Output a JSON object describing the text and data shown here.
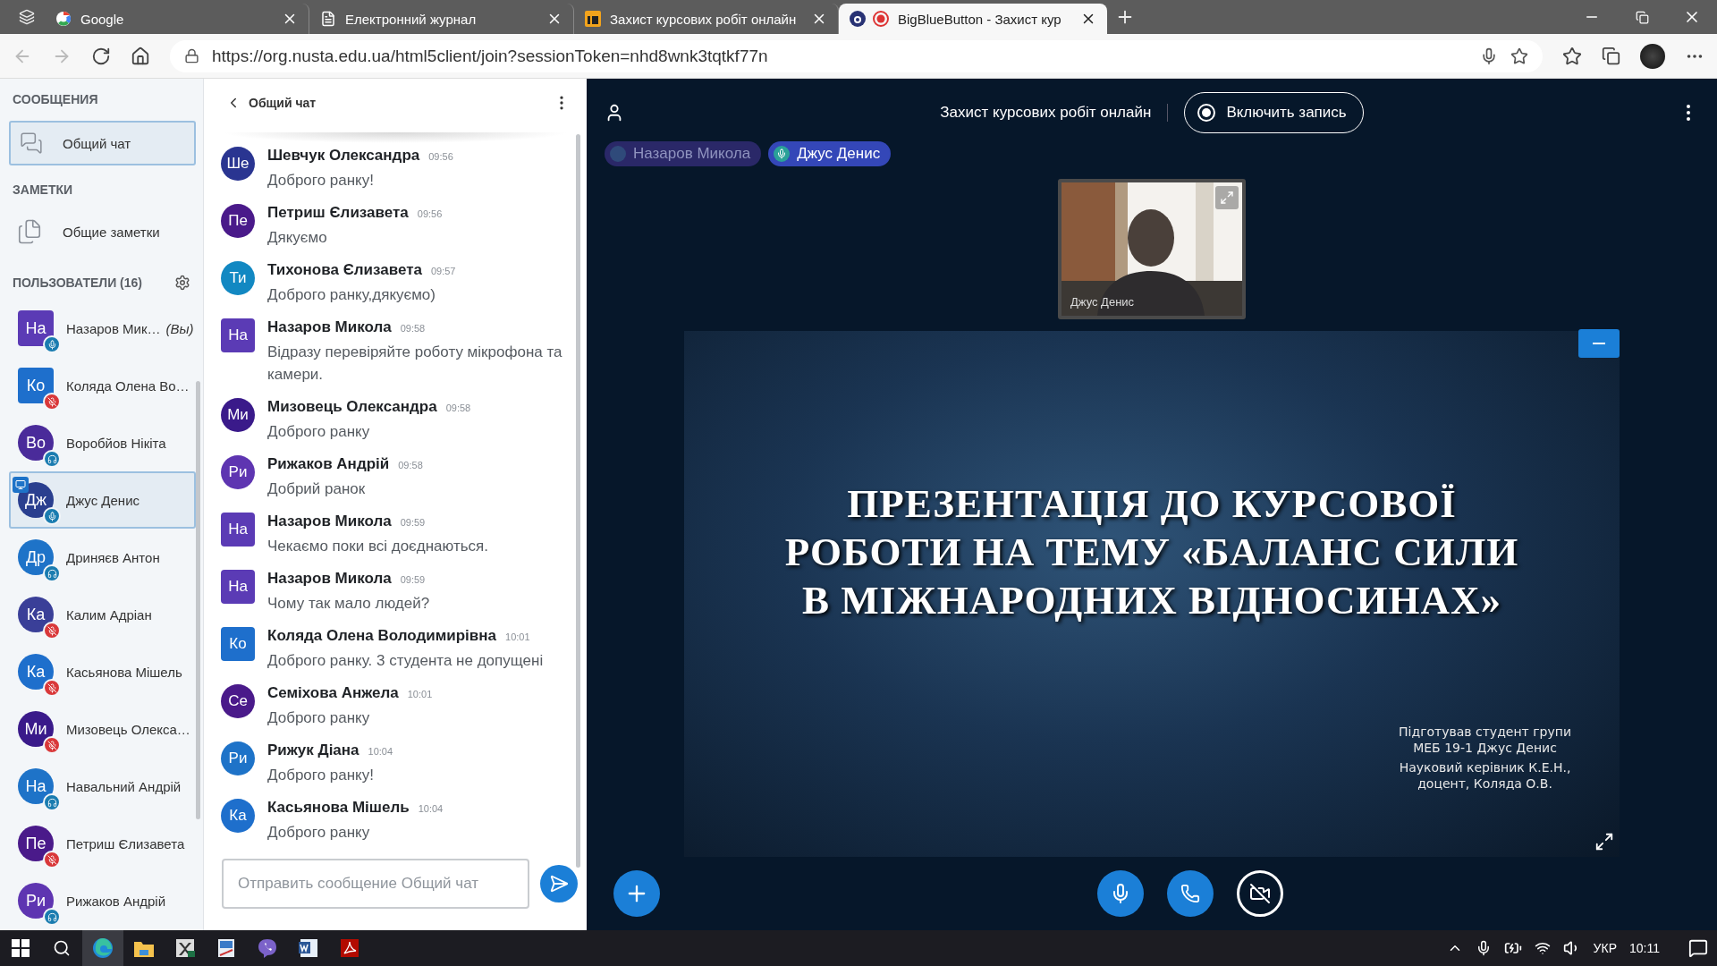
{
  "browser": {
    "tabs": [
      {
        "title": "Google",
        "kind": "google",
        "selected": false
      },
      {
        "title": "Електронний журнал",
        "kind": "page",
        "selected": false
      },
      {
        "title": "Захист курсових робіт онлайн",
        "kind": "logo",
        "selected": false
      },
      {
        "title": "BigBlueButton - Захист кур",
        "kind": "bbb",
        "selected": true
      }
    ],
    "url": "https://org.nusta.edu.ua/html5client/join?sessionToken=nhd8wnk3tqtkf77n"
  },
  "sidebar": {
    "messages_heading": "СООБЩЕНИЯ",
    "chat_item": {
      "label": "Общий чат",
      "selected": true
    },
    "notes_heading": "ЗАМЕТКИ",
    "notes_item": "Общие заметки",
    "users_heading": "ПОЛЬЗОВАТЕЛИ (16)",
    "users": [
      {
        "initials": "На",
        "name": "Назаров Мик…",
        "you_label": "(Вы)",
        "moderator": true,
        "kind": "mic",
        "color": "#5b3bb5",
        "presenter": false,
        "selected": false
      },
      {
        "initials": "Ко",
        "name": "Коляда Олена Во…",
        "moderator": true,
        "kind": "muted",
        "color": "#1e6fcc",
        "presenter": false,
        "selected": false
      },
      {
        "initials": "Во",
        "name": "Воробйов Нікіта",
        "moderator": false,
        "kind": "listen",
        "color": "#4a2b9a",
        "presenter": false,
        "selected": false
      },
      {
        "initials": "Дж",
        "name": "Джус Денис",
        "moderator": false,
        "kind": "mic",
        "color": "#2a3f8f",
        "presenter": true,
        "selected": true
      },
      {
        "initials": "Др",
        "name": "Дриняєв Антон",
        "moderator": false,
        "kind": "listen",
        "color": "#1e73c8",
        "presenter": false,
        "selected": false
      },
      {
        "initials": "Ка",
        "name": "Калим Адріан",
        "moderator": false,
        "kind": "muted",
        "color": "#3a3f98",
        "presenter": false,
        "selected": false
      },
      {
        "initials": "Ка",
        "name": "Касьянова Мішель",
        "moderator": false,
        "kind": "muted",
        "color": "#1e6fcc",
        "presenter": false,
        "selected": false
      },
      {
        "initials": "Ми",
        "name": "Мизовець Олекса…",
        "moderator": false,
        "kind": "muted",
        "color": "#3a1a8a",
        "presenter": false,
        "selected": false
      },
      {
        "initials": "На",
        "name": "Навальний Андрій",
        "moderator": false,
        "kind": "listen",
        "color": "#1e73c8",
        "presenter": false,
        "selected": false
      },
      {
        "initials": "Пе",
        "name": "Петриш Єлизавета",
        "moderator": false,
        "kind": "muted",
        "color": "#4a1a8a",
        "presenter": false,
        "selected": false
      },
      {
        "initials": "Ри",
        "name": "Рижаков Андрій",
        "moderator": false,
        "kind": "listen",
        "color": "#5e35b1",
        "presenter": false,
        "selected": false
      }
    ]
  },
  "chat": {
    "title": "Общий чат",
    "messages": [
      {
        "initials": "Ше",
        "author": "Шевчук Олександра",
        "time": "09:56",
        "text": "Доброго ранку!",
        "moderator": false,
        "color": "#2a3591"
      },
      {
        "initials": "Пе",
        "author": "Петриш Єлизавета",
        "time": "09:56",
        "text": "Дякуємо",
        "moderator": false,
        "color": "#4a1a8a"
      },
      {
        "initials": "Ти",
        "author": "Тихонова Єлизавета",
        "time": "09:57",
        "text": "Доброго ранку,дякуємо)",
        "moderator": false,
        "color": "#1288c2"
      },
      {
        "initials": "На",
        "author": "Назаров Микола",
        "time": "09:58",
        "text": "Відразу перевіряйте роботу мікрофона та камери.",
        "moderator": true,
        "color": "#5b3bb5"
      },
      {
        "initials": "Ми",
        "author": "Мизовець Олександра",
        "time": "09:58",
        "text": "Доброго ранку",
        "moderator": false,
        "color": "#3a1a8a"
      },
      {
        "initials": "Ри",
        "author": "Рижаков Андрій",
        "time": "09:58",
        "text": "Добрий ранок",
        "moderator": false,
        "color": "#5e35b1"
      },
      {
        "initials": "На",
        "author": "Назаров Микола",
        "time": "09:59",
        "text": "Чекаємо поки всі доєднаються.",
        "moderator": true,
        "color": "#5b3bb5"
      },
      {
        "initials": "На",
        "author": "Назаров Микола",
        "time": "09:59",
        "text": "Чому так мало людей?",
        "moderator": true,
        "color": "#5b3bb5"
      },
      {
        "initials": "Ко",
        "author": "Коляда Олена Володимирівна",
        "time": "10:01",
        "text": "Доброго ранку. 3 студента не допущені",
        "moderator": true,
        "color": "#1e6fcc"
      },
      {
        "initials": "Се",
        "author": "Семіхова Анжела",
        "time": "10:01",
        "text": "Доброго ранку",
        "moderator": false,
        "color": "#4a1a8a"
      },
      {
        "initials": "Ри",
        "author": "Рижук Діана",
        "time": "10:04",
        "text": "Доброго ранку!",
        "moderator": false,
        "color": "#1e73c8"
      },
      {
        "initials": "Ка",
        "author": "Касьянова Мішель",
        "time": "10:04",
        "text": "Доброго ранку",
        "moderator": false,
        "color": "#1e6fcc"
      }
    ],
    "input": {
      "placeholder": "Отправить сообщение Общий чат"
    }
  },
  "meeting": {
    "title": "Захист курсових робіт онлайн",
    "record_button": "Включить запись",
    "talkers": [
      {
        "name": "Назаров Микола",
        "talking": false
      },
      {
        "name": "Джус Денис",
        "talking": true
      }
    ],
    "video": {
      "name": "Джус Денис"
    },
    "slide": {
      "title_lines": [
        "ПРЕЗЕНТАЦІЯ ДО КУРСОВОЇ",
        "РОБОТИ НА ТЕМУ «БАЛАНС СИЛИ",
        "В МІЖНАРОДНИХ ВІДНОСИНАХ»"
      ],
      "author_lines": [
        "Підготував студент групи",
        "МЕБ 19-1 Джус Денис"
      ],
      "advisor_lines": [
        "Науковий керівник К.Е.Н.,",
        "доцент, Коляда О.В."
      ]
    },
    "controls": [
      {
        "kind": "mic",
        "active": true
      },
      {
        "kind": "phone",
        "active": true
      },
      {
        "kind": "camera",
        "active": false
      }
    ]
  },
  "taskbar": {
    "apps": [
      {
        "kind": "edge",
        "active": true
      },
      {
        "kind": "folder",
        "active": false
      },
      {
        "kind": "excel",
        "active": false
      },
      {
        "kind": "tool",
        "active": false
      },
      {
        "kind": "viber",
        "active": false
      },
      {
        "kind": "word",
        "active": false
      },
      {
        "kind": "acrobat",
        "active": false
      }
    ],
    "language": "УКР",
    "time": "10:11"
  }
}
